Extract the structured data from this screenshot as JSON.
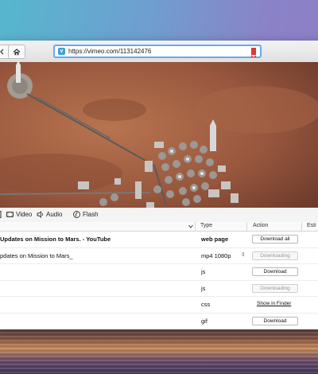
{
  "browser": {
    "url": "https://vimeo.com/113142476",
    "favicon_letter": "v"
  },
  "filters": [
    {
      "label": "Video",
      "icon": "video-icon"
    },
    {
      "label": "Audio",
      "icon": "audio-icon"
    },
    {
      "label": "Flash",
      "icon": "flash-icon"
    }
  ],
  "table": {
    "headers": {
      "type": "Type",
      "action": "Action",
      "estimate": "Esti"
    },
    "rows": [
      {
        "name": "Updates on Mission to Mars. - YouTube",
        "type": "web page",
        "action": "Download all",
        "action_kind": "button",
        "disabled": false,
        "name_bold": true,
        "type_bold": true
      },
      {
        "name": "pdates on Mission to Mars_",
        "type": "mp4 1080p",
        "quality_stepper": "⇕",
        "action": "Downloading",
        "action_kind": "button",
        "disabled": true,
        "name_bold": false,
        "type_bold": false
      },
      {
        "name": "",
        "type": "js",
        "action": "Download",
        "action_kind": "button",
        "disabled": false,
        "name_bold": false,
        "type_bold": false
      },
      {
        "name": "",
        "type": "js",
        "action": "Downloading",
        "action_kind": "button",
        "disabled": true,
        "name_bold": false,
        "type_bold": false
      },
      {
        "name": "",
        "type": "css",
        "action": "Show in Finder",
        "action_kind": "link",
        "disabled": false,
        "name_bold": false,
        "type_bold": false
      },
      {
        "name": "",
        "type": "gif",
        "action": "Download",
        "action_kind": "button",
        "disabled": false,
        "name_bold": false,
        "type_bold": false
      }
    ]
  },
  "colors": {
    "url_focus_ring": "#6aa9e6",
    "bookmark": "#d93a3a",
    "mars_surface": "#9a5a40"
  }
}
